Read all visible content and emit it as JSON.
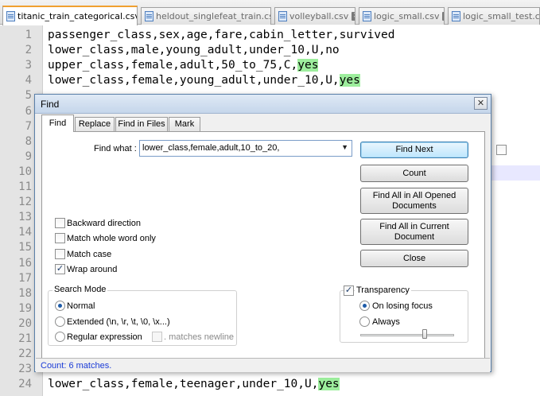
{
  "tabs": [
    {
      "label": "titanic_train_categorical.csv",
      "active": true
    },
    {
      "label": "heldout_singlefeat_train.csv"
    },
    {
      "label": "volleyball.csv"
    },
    {
      "label": "logic_small.csv"
    },
    {
      "label": "logic_small_test.csv"
    }
  ],
  "editor": {
    "lines": [
      {
        "num": "1",
        "text": "passenger_class,sex,age,fare,cabin_letter,survived"
      },
      {
        "num": "2",
        "text": "lower_class,male,young_adult,under_10,U,no"
      },
      {
        "num": "3",
        "text": "upper_class,female,adult,50_to_75,C,",
        "hl": "yes"
      },
      {
        "num": "4",
        "text": "lower_class,female,young_adult,under_10,U,",
        "hl": "yes"
      },
      {
        "num": "5",
        "text": ""
      },
      {
        "num": "6",
        "text": ""
      },
      {
        "num": "7",
        "text": ""
      },
      {
        "num": "8",
        "text": ""
      },
      {
        "num": "9",
        "text": ""
      },
      {
        "num": "10",
        "text": ""
      },
      {
        "num": "11",
        "text": ""
      },
      {
        "num": "12",
        "text": ""
      },
      {
        "num": "13",
        "text": ""
      },
      {
        "num": "14",
        "text": ""
      },
      {
        "num": "15",
        "text": ""
      },
      {
        "num": "16",
        "text": ""
      },
      {
        "num": "17",
        "text": ""
      },
      {
        "num": "18",
        "text": ""
      },
      {
        "num": "19",
        "text": ""
      },
      {
        "num": "20",
        "text": ""
      },
      {
        "num": "21",
        "text": ""
      },
      {
        "num": "22",
        "text": ""
      },
      {
        "num": "23",
        "text": ""
      },
      {
        "num": "24",
        "text": "lower_class,female,teenager,under_10,U,",
        "hl": "yes"
      }
    ]
  },
  "find_dialog": {
    "title": "Find",
    "close_glyph": "✕",
    "tabs": [
      "Find",
      "Replace",
      "Find in Files",
      "Mark"
    ],
    "find_what_label": "Find what :",
    "find_what_value": "lower_class,female,adult,10_to_20,",
    "dropdown_glyph": "▼",
    "buttons": {
      "find_next": "Find Next",
      "count": "Count",
      "find_all_opened": "Find All in All Opened Documents",
      "find_all_current": "Find All in Current Document",
      "close": "Close"
    },
    "options": {
      "backward": {
        "label": "Backward direction",
        "checked": false
      },
      "whole_word": {
        "label": "Match whole word only",
        "checked": false
      },
      "match_case": {
        "label": "Match case",
        "checked": false
      },
      "wrap_around": {
        "label": "Wrap around",
        "checked": true
      }
    },
    "check_glyph": "✓",
    "search_mode": {
      "title": "Search Mode",
      "normal": "Normal",
      "extended": "Extended (\\n, \\r, \\t, \\0, \\x...)",
      "regex": "Regular expression",
      "matches_newline": ". matches newline",
      "selected": "normal"
    },
    "transparency": {
      "title": "Transparency",
      "enabled": true,
      "on_losing_focus": "On losing focus",
      "always": "Always",
      "selected": "on_losing_focus",
      "slider_level": 0.7
    },
    "status": "Count: 6 matches."
  },
  "colors": {
    "accent": "#f0a030",
    "match_highlight": "#9dee9d",
    "status_text": "#1a3bd6"
  }
}
